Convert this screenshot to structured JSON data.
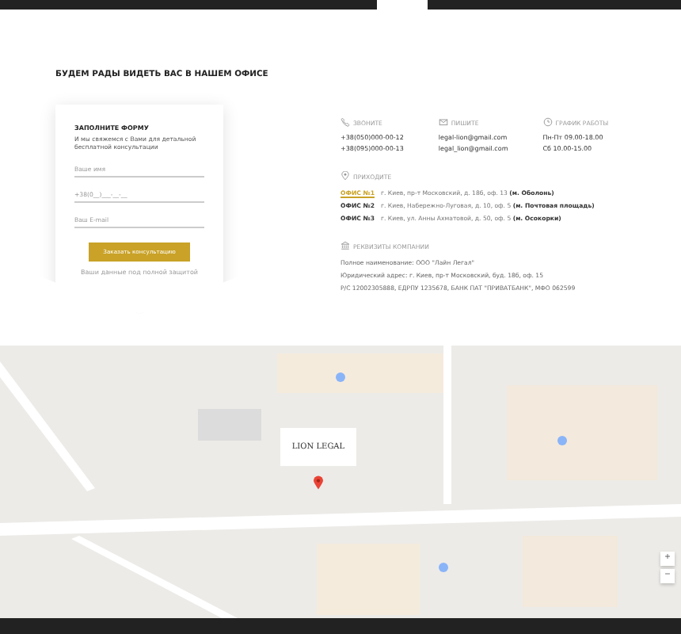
{
  "heading": "БУДЕМ РАДЫ ВИДЕТЬ ВАС В НАШЕМ ОФИСЕ",
  "form": {
    "title": "ЗАПОЛНИТЕ ФОРМУ",
    "description": "И мы свяжемся с Вами для детальной бесплатной консультации",
    "fields": [
      {
        "placeholder": "Ваше имя"
      },
      {
        "placeholder": "+38(0__)___-__-__"
      },
      {
        "placeholder": "Ваш E-mail"
      }
    ],
    "button": "Заказать консультацию",
    "note": "Ваши данные под полной защитой"
  },
  "contacts": [
    {
      "kind": "phone",
      "title": "ЗВОНИТЕ",
      "lines": [
        "+38(050)000-00-12",
        "+38(095)000-00-13"
      ]
    },
    {
      "kind": "mail",
      "title": "ПИШИТЕ",
      "lines": [
        "legal-lion@gmail.com",
        "legal_lion@gmail.com"
      ]
    },
    {
      "kind": "clock",
      "title": "ГРАФИК РАБОТЫ",
      "lines": [
        "Пн-Пт  09.00-18.00",
        "Сб  10.00-15.00"
      ]
    }
  ],
  "offices": {
    "title": "ПРИХОДИТЕ",
    "items": [
      {
        "name": "ОФИС №1",
        "address": "г. Киев, пр-т Московский, д. 18б, оф. 13 **(м. Оболонь)**",
        "selected": true
      },
      {
        "name": "ОФИС №2",
        "address": "г. Киев, Набережно-Луговая, д. 10, оф. 5 **(м. Почтовая площадь)**",
        "selected": false
      },
      {
        "name": "ОФИС №3",
        "address": "г. Киев, ул. Анны Ахматовой, д. 50, оф. 5 **(м. Осокорки)**",
        "selected": false
      }
    ]
  },
  "requisites": {
    "title": "РЕКВИЗИТЫ КОМПАНИИ",
    "lines": [
      "Полное наименование:  ООО \"Лайн Легал\"",
      "Юридический адрес:  г. Киев, пр-т Московский, буд. 18б, оф. 15",
      "Р/С 12002305888, ЕДРПУ 1235678, БАНК ПАТ \"ПРИВАТБАНК\", МФО 062599"
    ]
  },
  "map": {
    "logo": "LION LEGAL",
    "zoom_in": "+",
    "zoom_out": "−"
  }
}
